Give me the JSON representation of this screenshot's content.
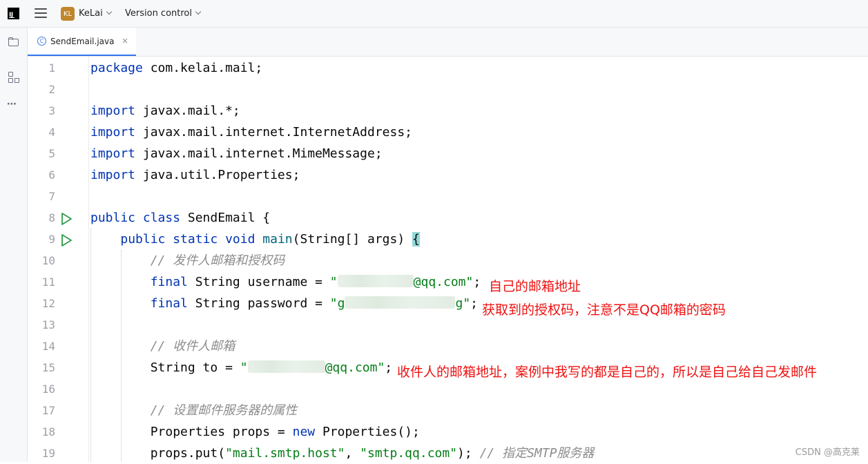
{
  "titlebar": {
    "app_logo_text": "IJ",
    "project_badge": "KL",
    "project_name": "KeLai",
    "vcs_label": "Version control"
  },
  "tabs": [
    {
      "icon": "C",
      "label": "SendEmail.java",
      "close": "×"
    }
  ],
  "toolstrip": {
    "more": "⋯"
  },
  "editor": {
    "lines": [
      {
        "n": "1",
        "parts": [
          [
            "kw",
            "package"
          ],
          [
            "",
            " com.kelai.mail;"
          ]
        ]
      },
      {
        "n": "2",
        "parts": []
      },
      {
        "n": "3",
        "parts": [
          [
            "kw",
            "import"
          ],
          [
            "",
            " javax.mail.*;"
          ]
        ]
      },
      {
        "n": "4",
        "parts": [
          [
            "kw",
            "import"
          ],
          [
            "",
            " javax.mail.internet.InternetAddress;"
          ]
        ]
      },
      {
        "n": "5",
        "parts": [
          [
            "kw",
            "import"
          ],
          [
            "",
            " javax.mail.internet.MimeMessage;"
          ]
        ]
      },
      {
        "n": "6",
        "parts": [
          [
            "kw",
            "import"
          ],
          [
            "",
            " java.util.Properties;"
          ]
        ]
      },
      {
        "n": "7",
        "parts": []
      },
      {
        "n": "8",
        "run": true,
        "parts": [
          [
            "kw",
            "public class"
          ],
          [
            "",
            " SendEmail {"
          ]
        ]
      },
      {
        "n": "9",
        "run": true,
        "parts": [
          [
            "",
            "    "
          ],
          [
            "kw",
            "public static void"
          ],
          [
            "",
            " "
          ],
          [
            "fn",
            "main"
          ],
          [
            "",
            "(String[] args) "
          ],
          [
            "brace-hl",
            "{"
          ]
        ]
      },
      {
        "n": "10",
        "parts": [
          [
            "",
            "        "
          ],
          [
            "cm",
            "// 发件人邮箱和授权码"
          ]
        ]
      },
      {
        "n": "11",
        "parts": [
          [
            "",
            "        "
          ],
          [
            "kw",
            "final"
          ],
          [
            "",
            " String username = "
          ],
          [
            "str",
            "\""
          ],
          [
            "blur",
            "110"
          ],
          [
            "str",
            "@qq.com\""
          ],
          [
            "",
            ";"
          ]
        ]
      },
      {
        "n": "12",
        "parts": [
          [
            "",
            "        "
          ],
          [
            "kw",
            "final"
          ],
          [
            "",
            " String password = "
          ],
          [
            "str",
            "\"g"
          ],
          [
            "blur",
            "160"
          ],
          [
            "str",
            "g\""
          ],
          [
            "",
            ";"
          ]
        ]
      },
      {
        "n": "13",
        "parts": []
      },
      {
        "n": "14",
        "parts": [
          [
            "",
            "        "
          ],
          [
            "cm",
            "// 收件人邮箱"
          ]
        ]
      },
      {
        "n": "15",
        "parts": [
          [
            "",
            "        String to = "
          ],
          [
            "str",
            "\""
          ],
          [
            "blur",
            "112"
          ],
          [
            "str",
            "@qq.com\""
          ],
          [
            "",
            ";"
          ]
        ]
      },
      {
        "n": "16",
        "parts": []
      },
      {
        "n": "17",
        "parts": [
          [
            "",
            "        "
          ],
          [
            "cm",
            "// 设置邮件服务器的属性"
          ]
        ]
      },
      {
        "n": "18",
        "parts": [
          [
            "",
            "        Properties props = "
          ],
          [
            "kw",
            "new"
          ],
          [
            "",
            " Properties();"
          ]
        ]
      },
      {
        "n": "19",
        "parts": [
          [
            "",
            "        props.put("
          ],
          [
            "str",
            "\"mail.smtp.host\""
          ],
          [
            "",
            ", "
          ],
          [
            "str",
            "\"smtp.qq.com\""
          ],
          [
            "",
            "); "
          ],
          [
            "cm",
            "// 指定SMTP服务器"
          ]
        ]
      }
    ]
  },
  "annotations": {
    "username_note": "自己的邮箱地址",
    "password_note": "获取到的授权码，注意不是QQ邮箱的密码",
    "to_note": "收件人的邮箱地址，案例中我写的都是自己的，所以是自己给自己发邮件"
  },
  "watermark": "CSDN @高克莱"
}
